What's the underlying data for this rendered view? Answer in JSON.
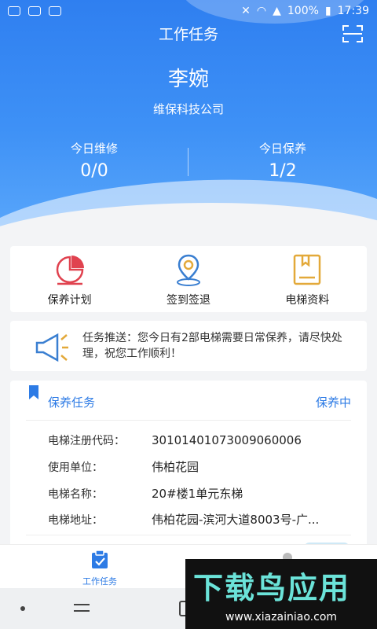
{
  "status_bar": {
    "battery": "100%",
    "time": "17:39"
  },
  "header": {
    "title": "工作任务"
  },
  "user": {
    "name": "李婉",
    "company": "维保科技公司"
  },
  "stats": [
    {
      "label": "今日维修",
      "value": "0/0"
    },
    {
      "label": "今日保养",
      "value": "1/2"
    }
  ],
  "actions": [
    {
      "label": "保养计划",
      "icon": "pie-chart-icon"
    },
    {
      "label": "签到签退",
      "icon": "location-pin-icon"
    },
    {
      "label": "电梯资料",
      "icon": "document-icon"
    }
  ],
  "notice": {
    "icon": "megaphone-icon",
    "text": "任务推送：您今日有2部电梯需要日常保养，请尽快处理，祝您工作顺利！"
  },
  "task": {
    "title": "保养任务",
    "status": "保养中",
    "fields": [
      {
        "key": "电梯注册代码：",
        "value": "30101401073009060006"
      },
      {
        "key": "使用单位：",
        "value": "伟柏花园"
      },
      {
        "key": "电梯名称：",
        "value": "20#楼1单元东梯"
      },
      {
        "key": "电梯地址：",
        "value": "伟柏花园-滨河大道8003号-广..."
      }
    ]
  },
  "tabbar": {
    "active_label": "工作任务"
  },
  "watermark": {
    "brand": "下载鸟应用",
    "url": "www.xiazainiao.com"
  },
  "colors": {
    "primary": "#2d7be5",
    "header_top": "#2f7ff0",
    "action_red": "#e0424f",
    "action_gold": "#e3a93a"
  }
}
